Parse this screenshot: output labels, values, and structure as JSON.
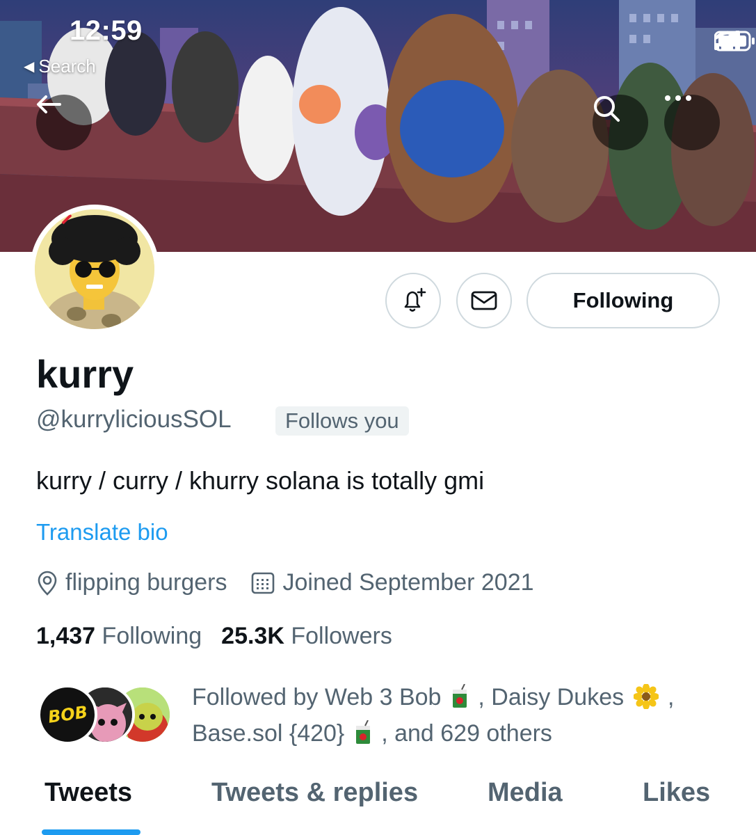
{
  "status_bar": {
    "time": "12:59",
    "back_label": "Search"
  },
  "banner": {
    "icons": {
      "back": "arrow-left-icon",
      "search": "search-icon",
      "more": "more-horizontal-icon"
    }
  },
  "profile": {
    "display_name": "kurry",
    "handle": "@kurryliciousSOL",
    "follows_you_badge": "Follows you",
    "bio": "kurry / curry / khurry solana is totally gmi",
    "translate_link": "Translate bio",
    "location": "flipping burgers",
    "joined": "Joined September 2021",
    "following_count": "1,437",
    "following_label": "Following",
    "followers_count": "25.3K",
    "followers_label": "Followers"
  },
  "actions": {
    "following_button": "Following",
    "icons": {
      "notify": "bell-plus-icon",
      "message": "envelope-icon"
    }
  },
  "followed_by": {
    "prefix": "Followed by ",
    "name_1": "Web 3 Bob",
    "sep_1": " , ",
    "name_2": "Daisy Dukes",
    "sep_2": " ,",
    "name_3": "Base.sol {420}",
    "suffix": " , and 629 others",
    "bob_avatar_text": "BOB"
  },
  "tabs": [
    {
      "label": "Tweets",
      "active": true
    },
    {
      "label": "Tweets & replies",
      "active": false
    },
    {
      "label": "Media",
      "active": false
    },
    {
      "label": "Likes",
      "active": false
    }
  ],
  "colors": {
    "accent": "#1d9bf0",
    "text_primary": "#0f1419",
    "text_secondary": "#536471",
    "border": "#cfd9de"
  }
}
